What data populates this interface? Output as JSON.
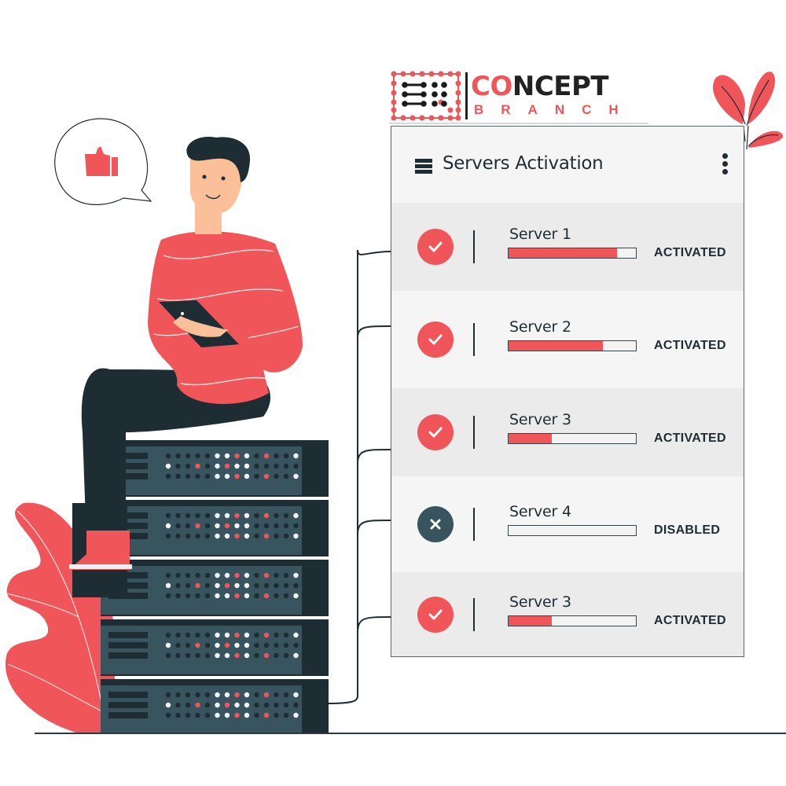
{
  "logo": {
    "word_primary_highlight": "CO",
    "word_primary_rest": "NCEPT",
    "word_secondary": "BRANCH"
  },
  "panel": {
    "title": "Servers Activation",
    "menu_icon": "hamburger-list-icon",
    "more_icon": "vertical-dots-icon",
    "servers": [
      {
        "name": "Server 1",
        "status": "ACTIVATED",
        "state": "ok",
        "progress_percent": 85,
        "icon": "check-icon"
      },
      {
        "name": "Server 2",
        "status": "ACTIVATED",
        "state": "ok",
        "progress_percent": 74,
        "icon": "check-icon"
      },
      {
        "name": "Server 3",
        "status": "ACTIVATED",
        "state": "ok",
        "progress_percent": 34,
        "icon": "check-icon"
      },
      {
        "name": "Server 4",
        "status": "DISABLED",
        "state": "off",
        "progress_percent": 0,
        "icon": "x-icon"
      },
      {
        "name": "Server 3",
        "status": "ACTIVATED",
        "state": "ok",
        "progress_percent": 34,
        "icon": "check-icon"
      }
    ]
  },
  "illustration": {
    "speech_bubble_icon": "thumbs-up-icon",
    "person_device": "tablet",
    "server_rack_units": 5
  },
  "colors": {
    "accent": "#f0555a",
    "dark": "#1e2d33",
    "rack": "#37545f",
    "panel_bg": "#f5f5f5",
    "panel_alt_bg": "#ebebeb",
    "skin": "#fbbf9a"
  }
}
